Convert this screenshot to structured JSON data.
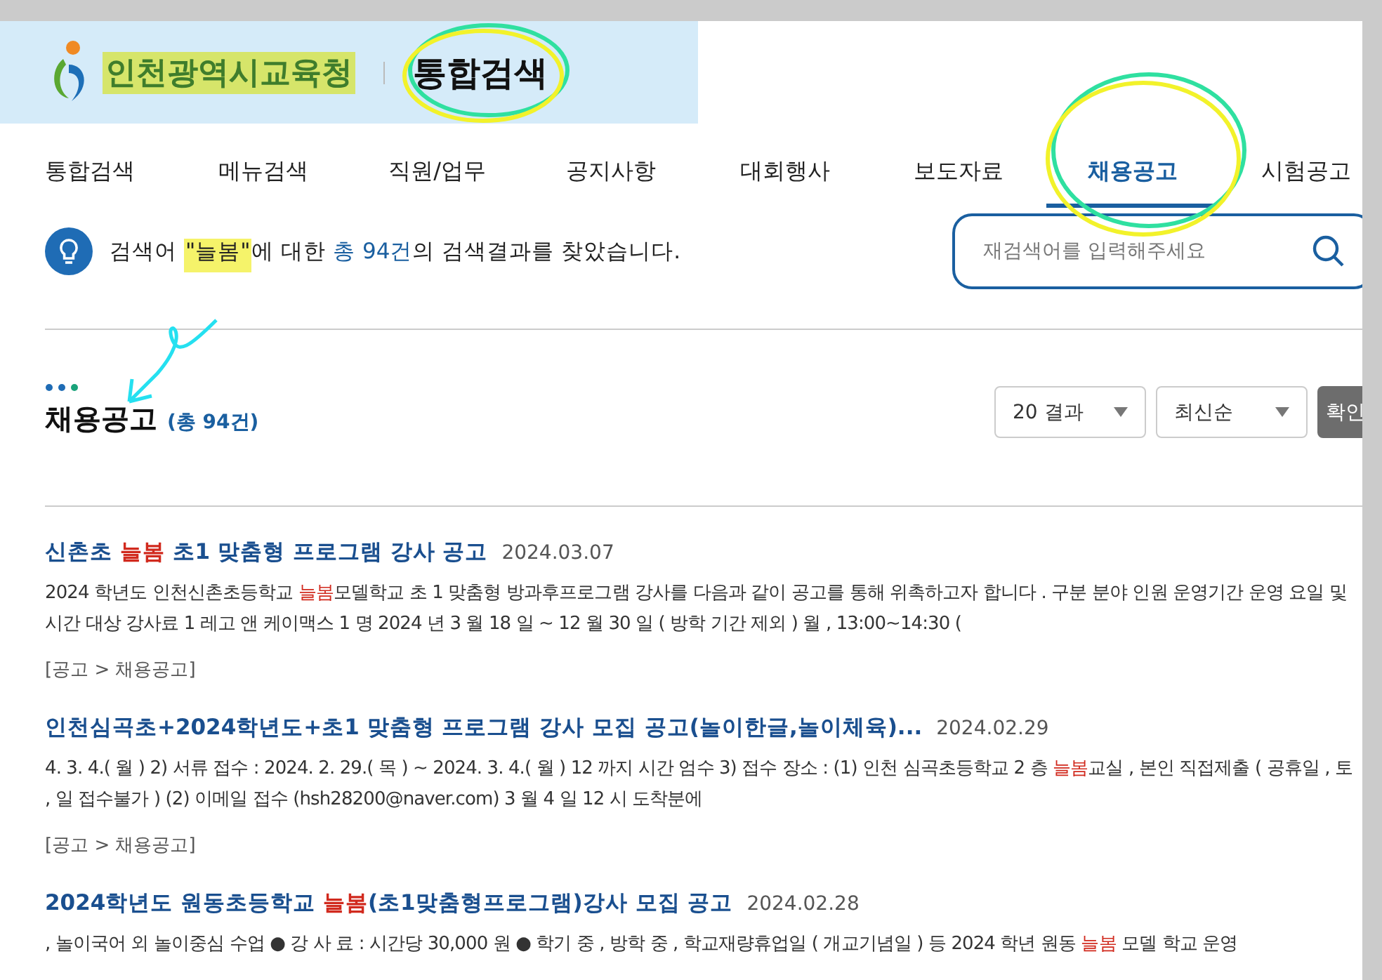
{
  "header": {
    "org_name": "인천광역시교육청",
    "page_title": "통합검색"
  },
  "tabs": [
    {
      "label": "통합검색",
      "selected": false
    },
    {
      "label": "메뉴검색",
      "selected": false
    },
    {
      "label": "직원/업무",
      "selected": false
    },
    {
      "label": "공지사항",
      "selected": false
    },
    {
      "label": "대회행사",
      "selected": false
    },
    {
      "label": "보도자료",
      "selected": false
    },
    {
      "label": "채용공고",
      "selected": true
    },
    {
      "label": "시험공고",
      "selected": false
    }
  ],
  "summary": {
    "parts": [
      {
        "text": "검색어 ",
        "kind": "plain"
      },
      {
        "text": "\"늘봄\"",
        "kind": "keyword"
      },
      {
        "text": "에 대한 ",
        "kind": "plain"
      },
      {
        "text": "총 94건",
        "kind": "count"
      },
      {
        "text": "의 검색결과를 찾았습니다.",
        "kind": "plain"
      }
    ]
  },
  "search": {
    "placeholder": "재검색어를 입력해주세요"
  },
  "section": {
    "title": "채용공고",
    "count": "(총 94건)",
    "page_size": "20 결과",
    "sort": "최신순",
    "confirm": "확인"
  },
  "results": [
    {
      "title": [
        {
          "text": "신촌초 ",
          "highlight": false
        },
        {
          "text": "늘봄",
          "highlight": true
        },
        {
          "text": " 초1 맞춤형 프로그램 강사 공고",
          "highlight": false
        }
      ],
      "date": "2024.03.07",
      "snippet": [
        {
          "text": "2024 학년도 인천신촌초등학교 ",
          "highlight": false
        },
        {
          "text": "늘봄",
          "highlight": true
        },
        {
          "text": "모델학교 초 1 맞춤형 방과후프로그램 강사를 다음과 같이 공고를 통해 위촉하고자 합니다 . 구분 분야 인원 운영기간 운영 요일 및 시간 대상 강사료 1 레고 앤 케이맥스 1 명 2024 년 3 월 18 일 ~ 12 월 30 일 ( 방학 기간 제외 ) 월 , 13:00~14:30 (",
          "highlight": false
        }
      ],
      "path": "[공고 > 채용공고]"
    },
    {
      "title": [
        {
          "text": "인천심곡초+2024학년도+초1 맞춤형 프로그램 강사 모집 공고(놀이한글,놀이체육)...",
          "highlight": false
        }
      ],
      "date": "2024.02.29",
      "snippet": [
        {
          "text": "4. 3. 4.( 월 ) 2) 서류 접수 : 2024. 2. 29.( 목 ) ~ 2024. 3. 4.( 월 ) 12 까지 시간 엄수 3) 접수 장소 : (1) 인천 심곡초등학교 2 층 ",
          "highlight": false
        },
        {
          "text": "늘봄",
          "highlight": true
        },
        {
          "text": "교실 , 본인 직접제출 ( 공휴일 , 토 , 일 접수불가 ) (2) 이메일 접수 (hsh28200@naver.com) 3 월 4 일 12 시 도착분에",
          "highlight": false
        }
      ],
      "path": "[공고 > 채용공고]"
    },
    {
      "title": [
        {
          "text": "2024학년도 원동초등학교 ",
          "highlight": false
        },
        {
          "text": "늘봄",
          "highlight": true
        },
        {
          "text": "(초1맞춤형프로그램)강사 모집 공고",
          "highlight": false
        }
      ],
      "date": "2024.02.28",
      "snippet": [
        {
          "text": ", 놀이국어 외 놀이중심 수업 ● 강 사 료 : 시간당 30,000 원 ● 학기 중 , 방학 중 , 학교재량휴업일 ( 개교기념일 ) 등 2024 학년 원동 ",
          "highlight": false
        },
        {
          "text": "늘봄",
          "highlight": true
        },
        {
          "text": " 모델 학교 운영",
          "highlight": false
        }
      ]
    }
  ]
}
